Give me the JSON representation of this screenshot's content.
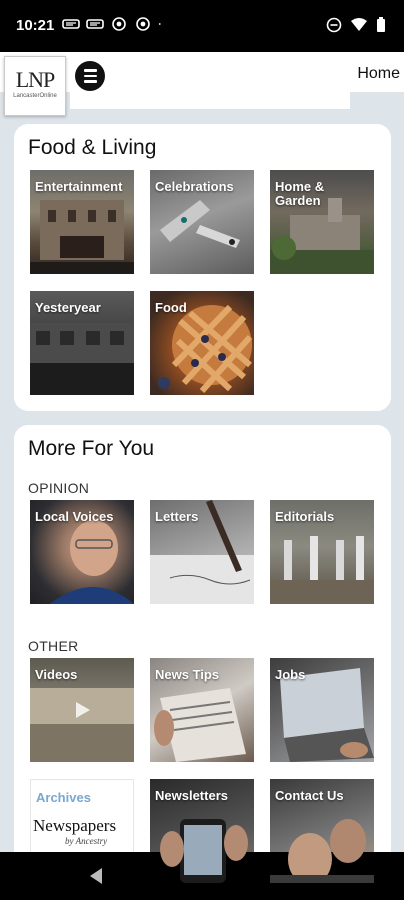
{
  "status_bar": {
    "time": "10:21",
    "left_icons": [
      "nyt-icon",
      "nyt-icon",
      "instagram-icon",
      "instagram-icon",
      "dot-icon"
    ],
    "right_icons": [
      "do-not-disturb-icon",
      "wifi-icon",
      "battery-icon"
    ]
  },
  "header": {
    "logo_text": "LNP",
    "logo_sub": "LancasterOnline",
    "home_label": "Home"
  },
  "food_living": {
    "title": "Food & Living",
    "tiles": [
      {
        "label": "Entertainment"
      },
      {
        "label": "Celebrations"
      },
      {
        "label": "Home & Garden"
      },
      {
        "label": "Yesteryear"
      },
      {
        "label": "Food"
      }
    ]
  },
  "more_for_you": {
    "title": "More For You",
    "opinion": {
      "label": "OPINION",
      "tiles": [
        {
          "label": "Local Voices"
        },
        {
          "label": "Letters"
        },
        {
          "label": "Editorials"
        }
      ]
    },
    "other": {
      "label": "OTHER",
      "tiles": [
        {
          "label": "Videos"
        },
        {
          "label": "News Tips"
        },
        {
          "label": "Jobs"
        },
        {
          "label": "Archives",
          "logo_text": "Newspapers",
          "logo_sub": "by Ancestry"
        },
        {
          "label": "Newsletters"
        },
        {
          "label": "Contact Us"
        }
      ]
    }
  },
  "colors": {
    "background": "#dde4ea",
    "card": "#ffffff",
    "archives_accent": "#7aa7cf",
    "logo_accent": "#2a8a3a"
  }
}
